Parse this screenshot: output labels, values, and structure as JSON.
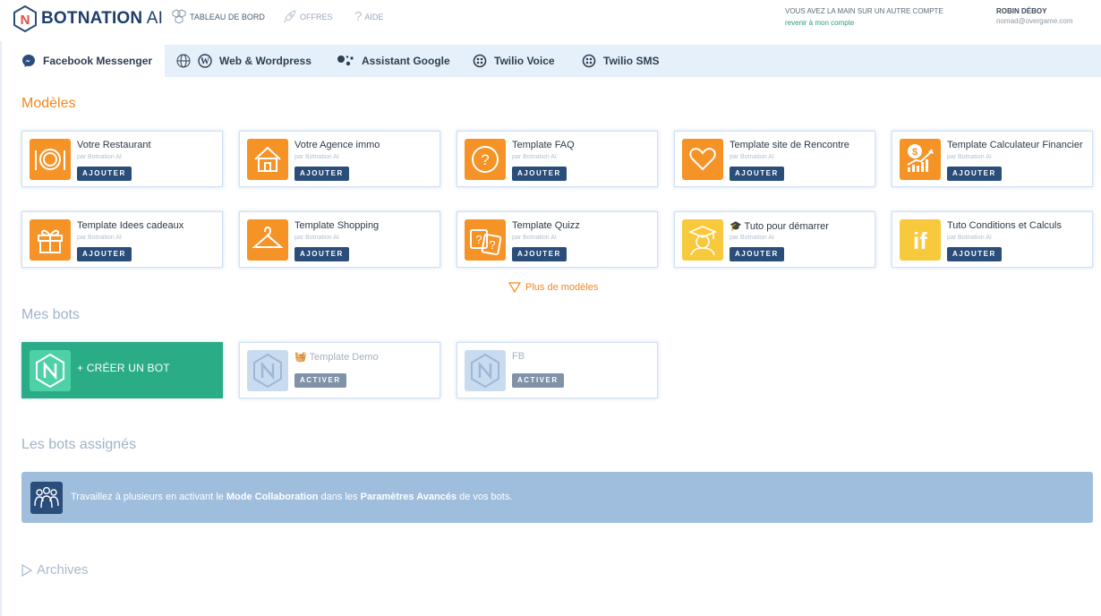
{
  "brand": {
    "name_first": "N",
    "name_rest": "BOTNATION",
    "name_ai": " AI"
  },
  "topnav": {
    "dashboard": "TABLEAU DE BORD",
    "offers": "OFFRES",
    "help": "AIDE"
  },
  "account": {
    "notice": "VOUS AVEZ LA MAIN SUR UN AUTRE COMPTE",
    "back_link": "revenir à mon compte",
    "user_name": "ROBIN DÉBOY",
    "user_email": "nomad@overgame.com"
  },
  "tabs": [
    {
      "label": "Facebook Messenger",
      "icon": "messenger-icon"
    },
    {
      "label": "Web & Wordpress",
      "icon": "wordpress-icon"
    },
    {
      "label": "Assistant Google",
      "icon": "google-assistant-icon"
    },
    {
      "label": "Twilio Voice",
      "icon": "twilio-icon"
    },
    {
      "label": "Twilio SMS",
      "icon": "twilio-icon"
    }
  ],
  "models": {
    "title": "Modèles",
    "by": "par Botnation AI",
    "add_label": "AJOUTER",
    "items": [
      {
        "title": "Votre Restaurant",
        "icon": "plate-icon"
      },
      {
        "title": "Votre Agence immo",
        "icon": "house-icon"
      },
      {
        "title": "Template FAQ",
        "icon": "question-icon"
      },
      {
        "title": "Template site de Rencontre",
        "icon": "heart-icon"
      },
      {
        "title": "Template Calculateur Financier",
        "icon": "finance-icon"
      },
      {
        "title": "Template Idees cadeaux",
        "icon": "gift-icon"
      },
      {
        "title": "Template Shopping",
        "icon": "hanger-icon"
      },
      {
        "title": "Template Quizz",
        "icon": "quiz-icon"
      },
      {
        "title": "🎓 Tuto pour démarrer",
        "icon": "graduate-icon"
      },
      {
        "title": "Tuto Conditions et Calculs",
        "icon": "if-icon"
      }
    ],
    "more_label": "Plus de modèles"
  },
  "my_bots": {
    "title": "Mes bots",
    "create_label": "+ CRÉER UN BOT",
    "activate_label": "ACTIVER",
    "items": [
      {
        "title": "🧺 Template Demo"
      },
      {
        "title": "FB"
      }
    ]
  },
  "assigned": {
    "title": "Les bots assignés",
    "text_a": "Travaillez à plusieurs en activant le ",
    "text_b": "Mode Collaboration",
    "text_c": " dans les ",
    "text_d": "Paramètres Avancés",
    "text_e": " de vos bots."
  },
  "archives": {
    "title": "Archives"
  },
  "colors": {
    "orange": "#f59327",
    "navy": "#2a4d7a",
    "green": "#2aac86",
    "yellow": "#f8c93c"
  }
}
